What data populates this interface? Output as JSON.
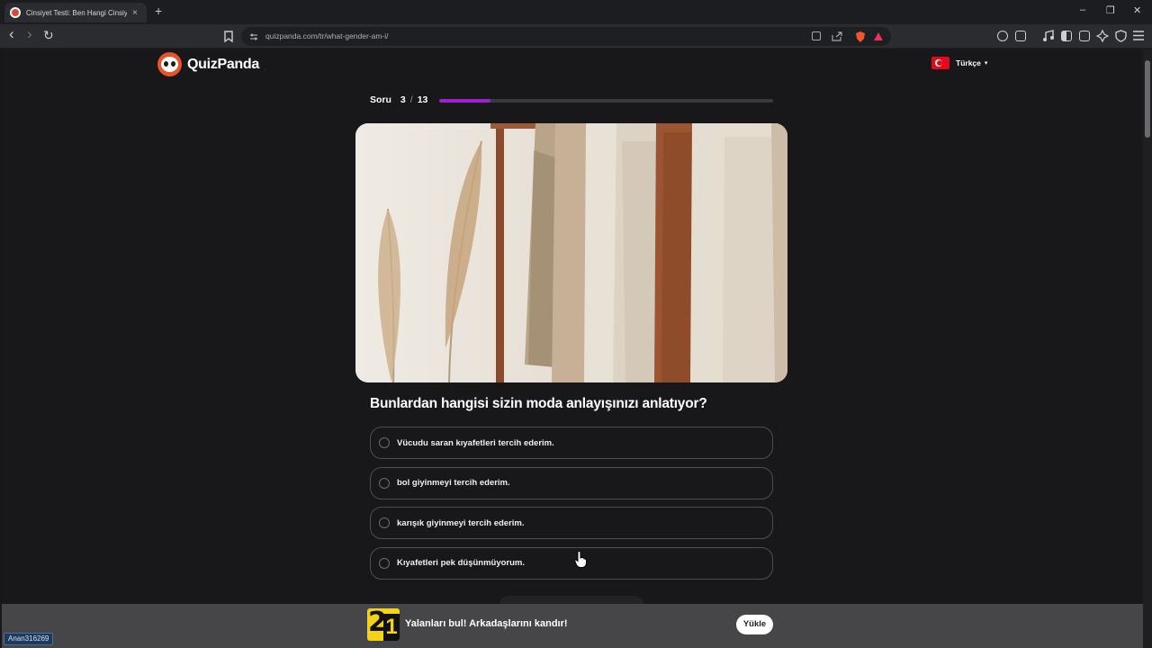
{
  "browser": {
    "tab_title": "Cinsiyet Testi: Ben Hangi Cinsiyetim",
    "tab_close": "×",
    "new_tab": "+",
    "url": "quizpanda.com/tr/what-gender-am-i/",
    "window_controls": {
      "minimize": "–",
      "restore": "❐",
      "close": "✕"
    },
    "nav": {
      "back": "‹",
      "forward": "›",
      "reload": "↻"
    }
  },
  "site": {
    "brand": "QuizPanda",
    "language": "Türkçe",
    "language_caret": "▾"
  },
  "quiz": {
    "progress_label": "Soru",
    "current": "3",
    "separator": "/",
    "total": "13",
    "progress_fraction": 0.1538,
    "question": "Bunlardan hangisi sizin moda anlayışınızı anlatıyor?",
    "options": [
      "Vücudu saran kıyafetleri tercih ederim.",
      "bol giyinmeyi tercih ederim.",
      "karışık giyinmeyi tercih ederim.",
      "Kıyafetleri pek düşünmüyorum."
    ],
    "accent_color": "#9d1fd4"
  },
  "banner": {
    "logo_digit_a": "2",
    "logo_digit_b": "1",
    "text": "Yalanları bul! Arkadaşlarını kandır!",
    "button": "Yükle"
  },
  "overlay": {
    "user_chip": "Anan316269"
  }
}
